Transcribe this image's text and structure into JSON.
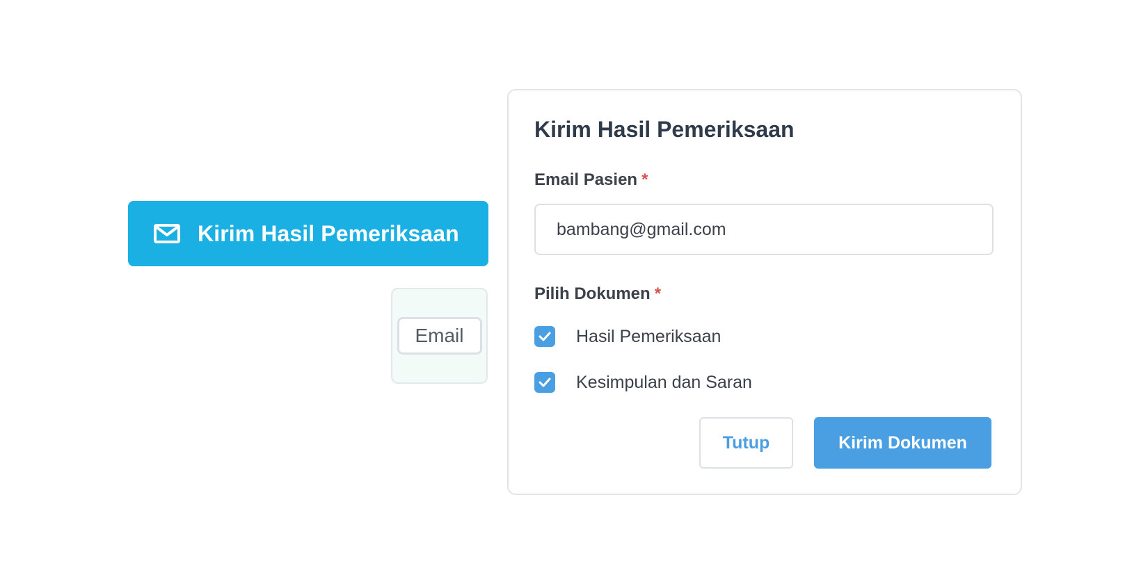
{
  "colors": {
    "trigger_bg": "#1BB0E3",
    "primary": "#4A9FE3",
    "email_card_bg": "#F3FBF8"
  },
  "trigger": {
    "label": "Kirim Hasil Pemeriksaan",
    "icon": "mail-icon"
  },
  "email_tag": {
    "label": "Email"
  },
  "modal": {
    "title": "Kirim Hasil Pemeriksaan",
    "email_label": "Email Pasien",
    "required_mark": "*",
    "email_value": "bambang@gmail.com",
    "docs_label": "Pilih Dokumen",
    "documents": [
      {
        "label": "Hasil Pemeriksaan",
        "checked": true
      },
      {
        "label": "Kesimpulan dan Saran",
        "checked": true
      }
    ],
    "close_label": "Tutup",
    "submit_label": "Kirim Dokumen"
  }
}
